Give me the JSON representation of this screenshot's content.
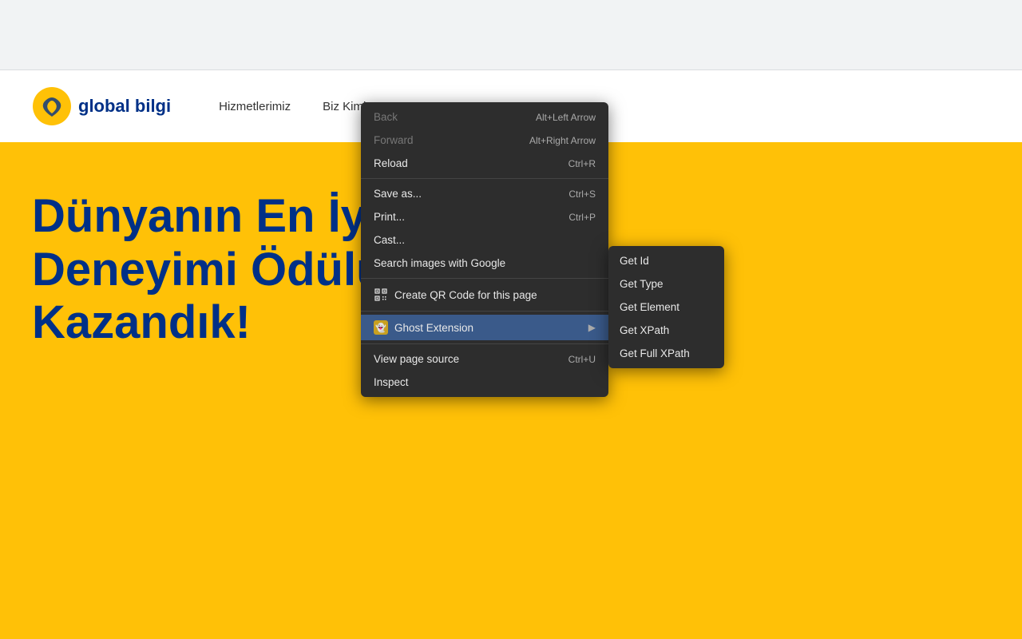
{
  "browser": {
    "top_bar_bg": "#f1f3f4"
  },
  "site": {
    "logo_text": "global bilgi",
    "nav_items": [
      {
        "label": "Hizmetlerimiz",
        "has_arrow": false
      },
      {
        "label": "Biz Kimiz",
        "has_arrow": true
      }
    ],
    "hero_title_line1": "Dünyanın En İyi Müşteri",
    "hero_title_line2": "Deneyimi Ödülünü",
    "hero_title_line3": "Kazandık!"
  },
  "context_menu": {
    "items": [
      {
        "id": "back",
        "label": "Back",
        "shortcut": "Alt+Left Arrow",
        "disabled": true,
        "icon": ""
      },
      {
        "id": "forward",
        "label": "Forward",
        "shortcut": "Alt+Right Arrow",
        "disabled": true,
        "icon": ""
      },
      {
        "id": "reload",
        "label": "Reload",
        "shortcut": "Ctrl+R",
        "disabled": false,
        "icon": ""
      },
      {
        "id": "sep1",
        "type": "separator"
      },
      {
        "id": "save_as",
        "label": "Save as...",
        "shortcut": "Ctrl+S",
        "disabled": false,
        "icon": ""
      },
      {
        "id": "print",
        "label": "Print...",
        "shortcut": "Ctrl+P",
        "disabled": false,
        "icon": ""
      },
      {
        "id": "cast",
        "label": "Cast...",
        "shortcut": "",
        "disabled": false,
        "icon": ""
      },
      {
        "id": "search_images",
        "label": "Search images with Google",
        "shortcut": "",
        "disabled": false,
        "icon": ""
      },
      {
        "id": "sep2",
        "type": "separator"
      },
      {
        "id": "qr_code",
        "label": "Create QR Code for this page",
        "shortcut": "",
        "disabled": false,
        "icon": "qr",
        "has_qr_icon": true
      },
      {
        "id": "sep3",
        "type": "separator"
      },
      {
        "id": "ghost_extension",
        "label": "Ghost Extension",
        "shortcut": "",
        "disabled": false,
        "icon": "ghost",
        "has_arrow": true,
        "highlighted": true
      },
      {
        "id": "sep4",
        "type": "separator"
      },
      {
        "id": "view_source",
        "label": "View page source",
        "shortcut": "Ctrl+U",
        "disabled": false,
        "icon": ""
      },
      {
        "id": "inspect",
        "label": "Inspect",
        "shortcut": "",
        "disabled": false,
        "icon": ""
      }
    ]
  },
  "submenu": {
    "items": [
      {
        "id": "get_id",
        "label": "Get Id"
      },
      {
        "id": "get_type",
        "label": "Get Type"
      },
      {
        "id": "get_element",
        "label": "Get Element"
      },
      {
        "id": "get_xpath",
        "label": "Get XPath"
      },
      {
        "id": "get_full_xpath",
        "label": "Get Full XPath"
      }
    ]
  }
}
